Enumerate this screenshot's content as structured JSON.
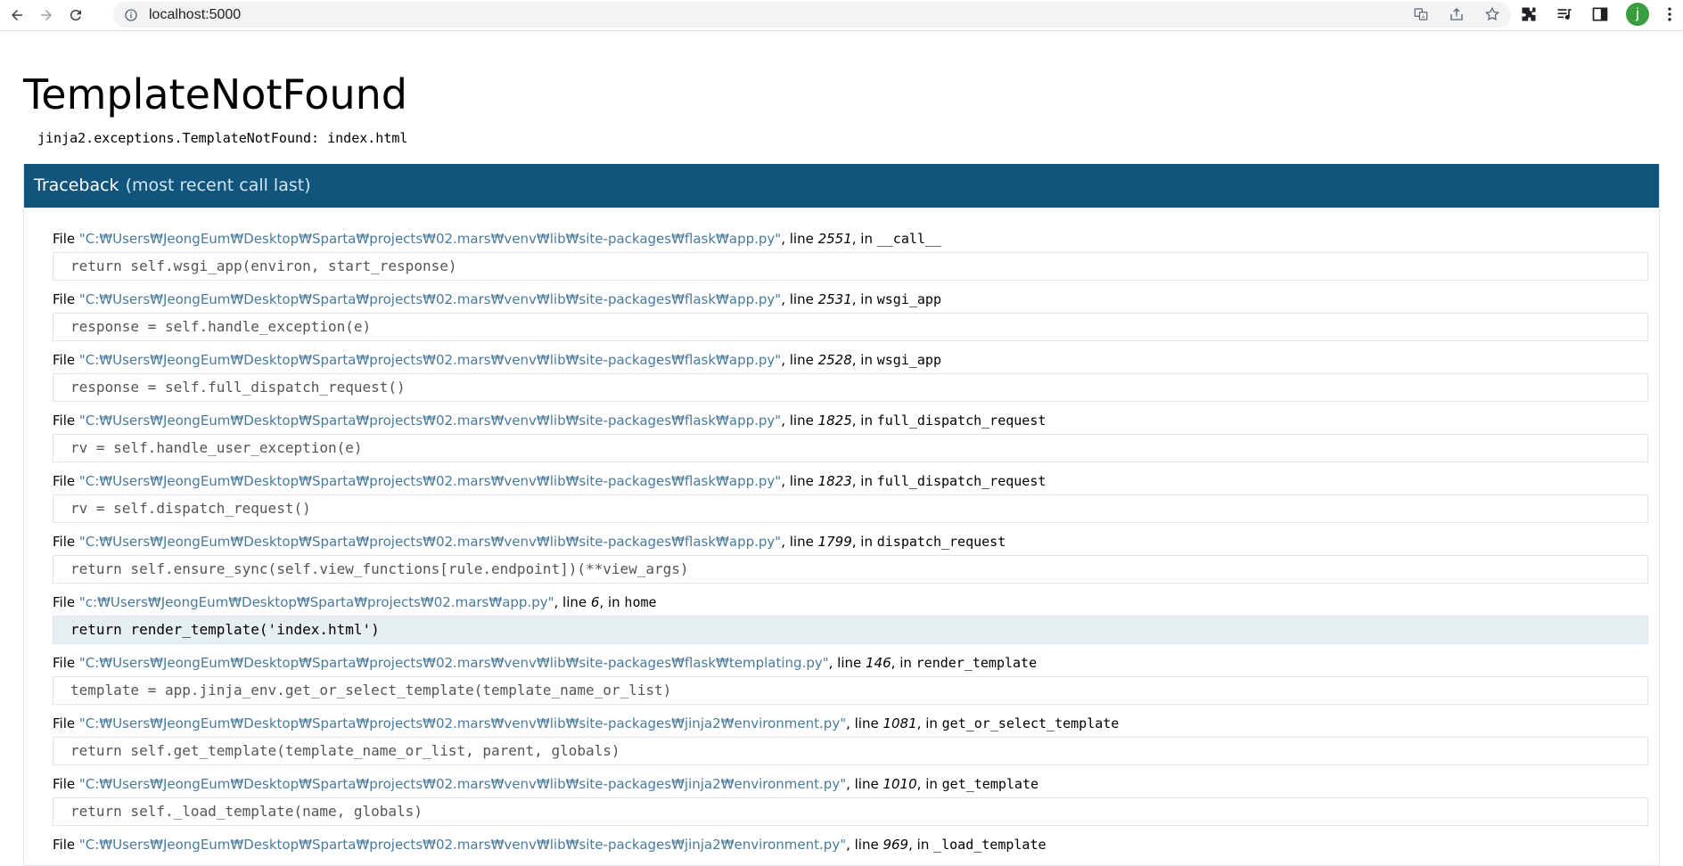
{
  "browser": {
    "url": "localhost:5000",
    "profile_initial": "j"
  },
  "page": {
    "title": "TemplateNotFound",
    "error_message": "jinja2.exceptions.TemplateNotFound: index.html",
    "traceback_title": "Traceback",
    "traceback_subtitle": "(most recent call last)"
  },
  "frames": [
    {
      "file_prefix": "File ",
      "filename": "\"C:₩Users₩JeongEum₩Desktop₩Sparta₩projects₩02.mars₩venv₩lib₩site-packages₩flask₩app.py\"",
      "line_prefix": ", line ",
      "lineno": "2551",
      "in_prefix": ", in ",
      "func": "__call__",
      "code": "return self.wsgi_app(environ, start_response)"
    },
    {
      "file_prefix": "File ",
      "filename": "\"C:₩Users₩JeongEum₩Desktop₩Sparta₩projects₩02.mars₩venv₩lib₩site-packages₩flask₩app.py\"",
      "line_prefix": ", line ",
      "lineno": "2531",
      "in_prefix": ", in ",
      "func": "wsgi_app",
      "code": "response = self.handle_exception(e)"
    },
    {
      "file_prefix": "File ",
      "filename": "\"C:₩Users₩JeongEum₩Desktop₩Sparta₩projects₩02.mars₩venv₩lib₩site-packages₩flask₩app.py\"",
      "line_prefix": ", line ",
      "lineno": "2528",
      "in_prefix": ", in ",
      "func": "wsgi_app",
      "code": "response = self.full_dispatch_request()"
    },
    {
      "file_prefix": "File ",
      "filename": "\"C:₩Users₩JeongEum₩Desktop₩Sparta₩projects₩02.mars₩venv₩lib₩site-packages₩flask₩app.py\"",
      "line_prefix": ", line ",
      "lineno": "1825",
      "in_prefix": ", in ",
      "func": "full_dispatch_request",
      "code": "rv = self.handle_user_exception(e)"
    },
    {
      "file_prefix": "File ",
      "filename": "\"C:₩Users₩JeongEum₩Desktop₩Sparta₩projects₩02.mars₩venv₩lib₩site-packages₩flask₩app.py\"",
      "line_prefix": ", line ",
      "lineno": "1823",
      "in_prefix": ", in ",
      "func": "full_dispatch_request",
      "code": "rv = self.dispatch_request()"
    },
    {
      "file_prefix": "File ",
      "filename": "\"C:₩Users₩JeongEum₩Desktop₩Sparta₩projects₩02.mars₩venv₩lib₩site-packages₩flask₩app.py\"",
      "line_prefix": ", line ",
      "lineno": "1799",
      "in_prefix": ", in ",
      "func": "dispatch_request",
      "code": "return self.ensure_sync(self.view_functions[rule.endpoint])(**view_args)"
    },
    {
      "file_prefix": "File ",
      "filename": "\"c:₩Users₩JeongEum₩Desktop₩Sparta₩projects₩02.mars₩app.py\"",
      "line_prefix": ", line ",
      "lineno": "6",
      "in_prefix": ", in ",
      "func": "home",
      "code": "return render_template('index.html')",
      "current": true
    },
    {
      "file_prefix": "File ",
      "filename": "\"C:₩Users₩JeongEum₩Desktop₩Sparta₩projects₩02.mars₩venv₩lib₩site-packages₩flask₩templating.py\"",
      "line_prefix": ", line ",
      "lineno": "146",
      "in_prefix": ", in ",
      "func": "render_template",
      "code": "template = app.jinja_env.get_or_select_template(template_name_or_list)"
    },
    {
      "file_prefix": "File ",
      "filename": "\"C:₩Users₩JeongEum₩Desktop₩Sparta₩projects₩02.mars₩venv₩lib₩site-packages₩jinja2₩environment.py\"",
      "line_prefix": ", line ",
      "lineno": "1081",
      "in_prefix": ", in ",
      "func": "get_or_select_template",
      "code": "return self.get_template(template_name_or_list, parent, globals)"
    },
    {
      "file_prefix": "File ",
      "filename": "\"C:₩Users₩JeongEum₩Desktop₩Sparta₩projects₩02.mars₩venv₩lib₩site-packages₩jinja2₩environment.py\"",
      "line_prefix": ", line ",
      "lineno": "1010",
      "in_prefix": ", in ",
      "func": "get_template",
      "code": "return self._load_template(name, globals)"
    },
    {
      "file_prefix": "File ",
      "filename": "\"C:₩Users₩JeongEum₩Desktop₩Sparta₩projects₩02.mars₩venv₩lib₩site-packages₩jinja2₩environment.py\"",
      "line_prefix": ", line ",
      "lineno": "969",
      "in_prefix": ", in ",
      "func": "_load_template",
      "code": ""
    }
  ],
  "colors": {
    "header_bg": "#11557c",
    "filename": "#4a7a9a",
    "current_frame_bg": "#e7eef1"
  }
}
